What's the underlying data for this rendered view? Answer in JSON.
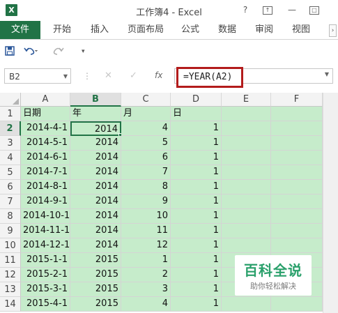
{
  "window": {
    "app_icon": "X",
    "title": "工作簿4 - Excel",
    "help_label": "?",
    "restore_label": "↑",
    "minimize_label": "—",
    "close_label": "□"
  },
  "ribbon": {
    "file_tab": "文件",
    "tabs": [
      "开始",
      "插入",
      "页面布局",
      "公式",
      "数据",
      "审阅",
      "视图"
    ],
    "more_label": "›"
  },
  "formula_bar": {
    "name_box": "B2",
    "fx_label": "fx",
    "formula": "=YEAR(A2)"
  },
  "sheet": {
    "columns": [
      "A",
      "B",
      "C",
      "D",
      "E",
      "F"
    ],
    "selected_column": "B",
    "selected_row": "2",
    "rows": [
      {
        "num": "1",
        "cells": [
          "日期",
          "年",
          "月",
          "日"
        ]
      },
      {
        "num": "2",
        "cells": [
          "2014-4-1",
          "2014",
          "4",
          "1"
        ]
      },
      {
        "num": "3",
        "cells": [
          "2014-5-1",
          "2014",
          "5",
          "1"
        ]
      },
      {
        "num": "4",
        "cells": [
          "2014-6-1",
          "2014",
          "6",
          "1"
        ]
      },
      {
        "num": "5",
        "cells": [
          "2014-7-1",
          "2014",
          "7",
          "1"
        ]
      },
      {
        "num": "6",
        "cells": [
          "2014-8-1",
          "2014",
          "8",
          "1"
        ]
      },
      {
        "num": "7",
        "cells": [
          "2014-9-1",
          "2014",
          "9",
          "1"
        ]
      },
      {
        "num": "8",
        "cells": [
          "2014-10-1",
          "2014",
          "10",
          "1"
        ]
      },
      {
        "num": "9",
        "cells": [
          "2014-11-1",
          "2014",
          "11",
          "1"
        ]
      },
      {
        "num": "10",
        "cells": [
          "2014-12-1",
          "2014",
          "12",
          "1"
        ]
      },
      {
        "num": "11",
        "cells": [
          "2015-1-1",
          "2015",
          "1",
          "1"
        ]
      },
      {
        "num": "12",
        "cells": [
          "2015-2-1",
          "2015",
          "2",
          "1"
        ]
      },
      {
        "num": "13",
        "cells": [
          "2015-3-1",
          "2015",
          "3",
          "1"
        ]
      },
      {
        "num": "14",
        "cells": [
          "2015-4-1",
          "2015",
          "4",
          "1"
        ]
      }
    ]
  },
  "watermark": {
    "title": "百科全说",
    "subtitle": "助你轻松解决"
  },
  "colors": {
    "excel_green": "#217346",
    "cell_fill": "#c6eccb",
    "highlight_border": "#b31c1c",
    "watermark_green": "#2aa06b"
  },
  "icons": [
    "excel-logo-icon",
    "save-icon",
    "undo-icon",
    "redo-icon",
    "customize-qat-icon",
    "cancel-icon",
    "enter-icon",
    "fx-icon",
    "dropdown-icon"
  ]
}
